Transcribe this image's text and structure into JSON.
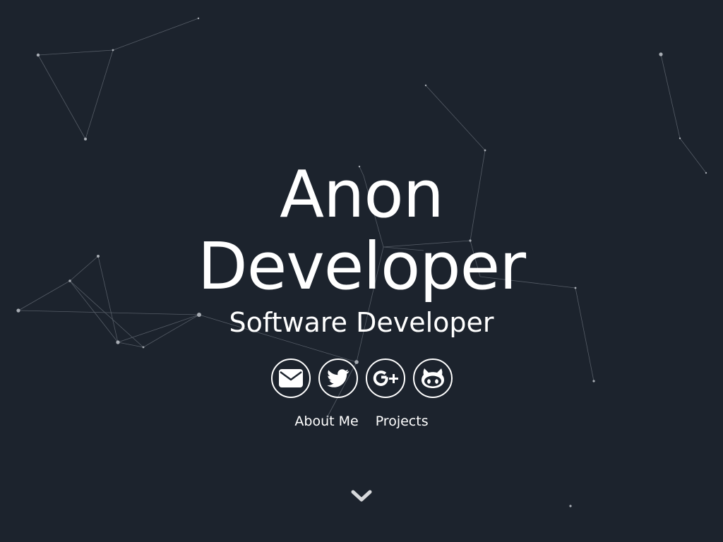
{
  "hero": {
    "name_line1": "Anon",
    "name_line2": "Developer",
    "subtitle": "Software Developer"
  },
  "socials": [
    {
      "label": "Email",
      "icon": "envelope-icon"
    },
    {
      "label": "Twitter",
      "icon": "twitter-icon"
    },
    {
      "label": "Google Plus",
      "icon": "google-plus-icon"
    },
    {
      "label": "GitHub",
      "icon": "github-icon"
    }
  ],
  "nav": {
    "about_label": "About Me",
    "projects_label": "Projects"
  },
  "scroll": {
    "icon": "chevron-down-icon"
  },
  "colors": {
    "background": "#1c232d",
    "foreground": "#ffffff",
    "particle": "#8a9099"
  }
}
